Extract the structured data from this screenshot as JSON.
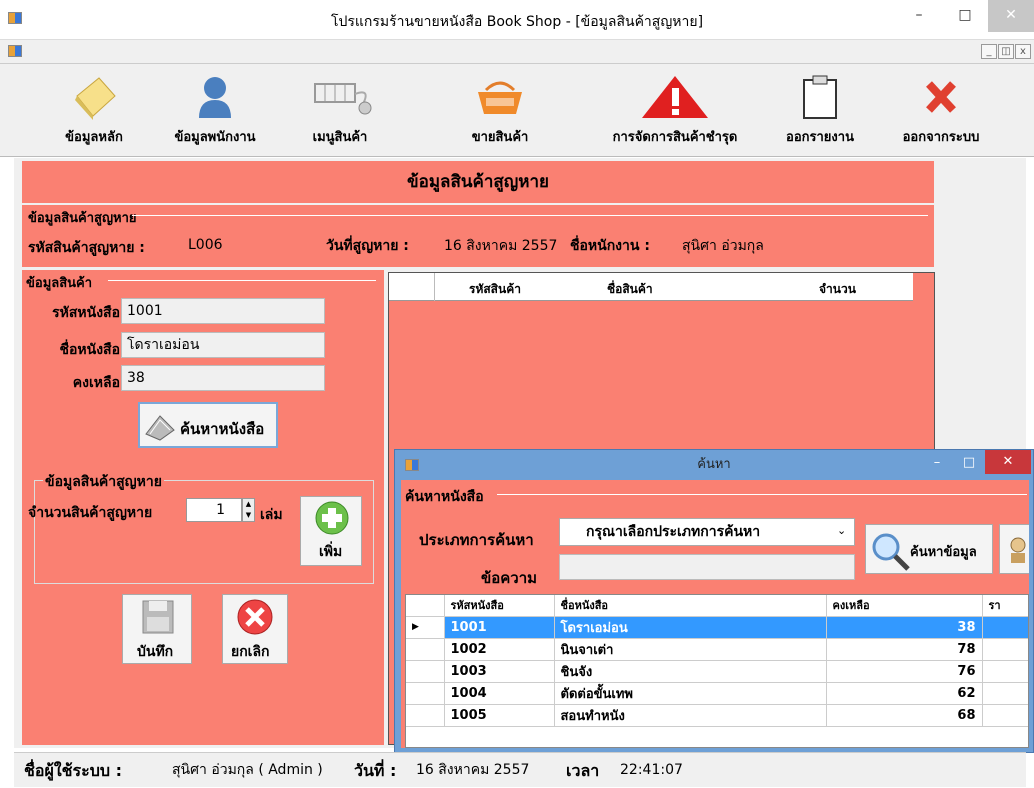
{
  "window": {
    "title": "โปรแกรมร้านขายหนังสือ Book Shop - [ข้อมูลสินค้าสูญหาย]"
  },
  "toolbar": {
    "items": [
      {
        "label": "ข้อมูลหลัก",
        "icon": "notes-icon"
      },
      {
        "label": "ข้อมูลพนักงาน",
        "icon": "user-icon"
      },
      {
        "label": "เมนูสินค้า",
        "icon": "cart-icon"
      },
      {
        "label": "ขายสินค้า",
        "icon": "basket-icon"
      },
      {
        "label": "การจัดการสินค้าชำรุด",
        "icon": "warning-icon"
      },
      {
        "label": "ออกรายงาน",
        "icon": "clipboard-icon"
      },
      {
        "label": "ออกจากระบบ",
        "icon": "close-x-icon"
      }
    ]
  },
  "page": {
    "header": "ข้อมูลสินค้าสูญหาย"
  },
  "lost_info": {
    "group_title": "ข้อมูลสินค้าสูญหาย",
    "code_label": "รหัสสินค้าสูญหาย :",
    "code_value": "L006",
    "date_label": "วันที่สูญหาย :",
    "date_value": "16 สิงหาคม 2557",
    "staff_label": "ชื่อหนักงาน :",
    "staff_value": "สุนิศา อ่วมกุล"
  },
  "product_info": {
    "group_title": "ข้อมูลสินค้า",
    "book_code_label": "รหัสหนังสือ",
    "book_code_value": "1001",
    "book_name_label": "ชื่อหนังสือ",
    "book_name_value": "โดราเอม่อน",
    "remaining_label": "คงเหลือ",
    "remaining_value": "38",
    "search_button": "ค้นหาหนังสือ"
  },
  "lost_qty": {
    "group_title": "ข้อมูลสินค้าสูญหาย",
    "qty_label": "จำนวนสินค้าสูญหาย",
    "qty_value": "1",
    "unit": "เล่ม",
    "add_button": "เพิ่ม"
  },
  "actions": {
    "save": "บันทึก",
    "cancel": "ยกเลิก"
  },
  "lost_grid": {
    "columns": [
      "รหัสสินค้า",
      "ชื่อสินค้า",
      "จำนวน"
    ]
  },
  "dialog": {
    "title": "ค้นหา",
    "group_title": "ค้นหาหนังสือ",
    "type_label": "ประเภทการค้นหา",
    "type_selected": "กรุณาเลือกประเภทการค้นหา",
    "text_label": "ข้อความ",
    "text_value": "",
    "search_button": "ค้นหาข้อมูล",
    "columns": [
      "รหัสหนังสือ",
      "ชื่อหนังสือ",
      "คงเหลือ",
      "รา"
    ],
    "rows": [
      {
        "code": "1001",
        "name": "โดราเอม่อน",
        "qty": "38"
      },
      {
        "code": "1002",
        "name": "นินจาเต่า",
        "qty": "78"
      },
      {
        "code": "1003",
        "name": "ชินจัง",
        "qty": "76"
      },
      {
        "code": "1004",
        "name": "ตัดต่อขั้นเทพ",
        "qty": "62"
      },
      {
        "code": "1005",
        "name": "สอนทำหนัง",
        "qty": "68"
      }
    ]
  },
  "status": {
    "user_label": "ชื่อผู้ใช้ระบบ :",
    "user_value": "สุนิศา อ่วมกุล  ( Admin )",
    "date_label": "วันที่ :",
    "date_value": "16 สิงหาคม 2557",
    "time_label": "เวลา",
    "time_value": "22:41:07"
  },
  "colors": {
    "panel": "#fa8072",
    "selection": "#3399ff",
    "dialog_frame": "#6ea0d6"
  }
}
